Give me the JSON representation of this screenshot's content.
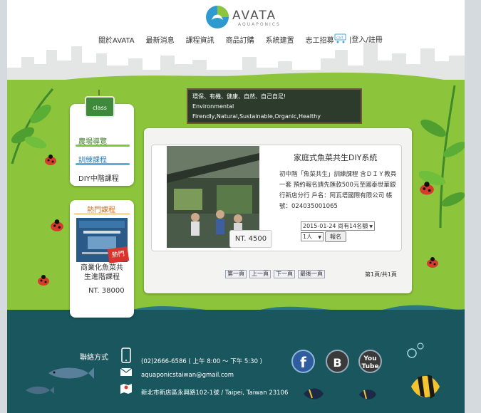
{
  "brand": {
    "name": "AVATA",
    "sub": "AQUAPONICS"
  },
  "nav": {
    "items": [
      "關於AVATA",
      "最新消息",
      "課程資訊",
      "商品訂購",
      "系統建置",
      "志工招募"
    ],
    "cart_label": "cart",
    "login": "|登入/註冊"
  },
  "sidebar": {
    "sign_label": "class",
    "links": [
      "農場導覽",
      "訓練課程",
      "DIY中階課程"
    ]
  },
  "hot": {
    "title": "熱門課程",
    "badge": "熱門",
    "name": "商業化魚菜共生進階課程",
    "price": "NT. 38000"
  },
  "board": {
    "line1": "環保、有機、健康、自然、自己自足!",
    "line2": "Environmental",
    "line3": "Firendly,Natural,Sustainable,Organic,Healthy"
  },
  "product": {
    "title": "家庭式魚菜共生DIY系統",
    "desc": "初中階「魚菜共生」訓練課程 含ＤＩＹ教具一套 預約報名請先匯款500元至國泰世華銀行新店分行 戶名：阿瓦塔國際有限公司 帳號：024035001065",
    "price": "NT. 4500",
    "date_option": "2015-01-24 尚有14名額",
    "qty_option": "1人",
    "signup": "報名"
  },
  "pager": {
    "first": "第一頁",
    "prev": "上一頁",
    "next": "下一頁",
    "last": "最後一頁",
    "info": "第1頁/共1頁"
  },
  "footer": {
    "title": "聯絡方式",
    "phone": "(02)2666-6586 ( 上午 8:00 ～ 下午 5:30 )",
    "email": "aquaponicstaiwan@gmail.com",
    "address": "新北市新店區永興路102-1號 / Taipei, Taiwan 23106",
    "youtube_1": "You",
    "youtube_2": "Tube"
  },
  "colors": {
    "grass": "#8cc43c",
    "sea": "#19565e",
    "accent_orange": "#d0731e"
  }
}
